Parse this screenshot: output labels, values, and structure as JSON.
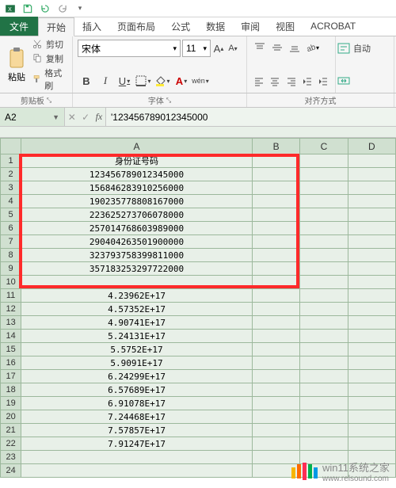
{
  "qat": {
    "excel_icon": "X",
    "save": "save",
    "undo": "undo",
    "redo": "redo"
  },
  "tabs": {
    "file": "文件",
    "items": [
      "开始",
      "插入",
      "页面布局",
      "公式",
      "数据",
      "审阅",
      "视图",
      "ACROBAT"
    ],
    "active_index": 0
  },
  "ribbon": {
    "clipboard": {
      "paste": "粘贴",
      "cut": "剪切",
      "copy": "复制",
      "format_painter": "格式刷"
    },
    "font": {
      "name": "宋体",
      "size": "11",
      "bold": "B",
      "italic": "I",
      "underline": "U",
      "wen": "wén"
    },
    "wrap": {
      "auto": "自动"
    },
    "group_titles": {
      "clipboard": "剪贴板",
      "font": "字体",
      "align": "对齐方式"
    }
  },
  "formula_bar": {
    "name_box": "A2",
    "value": "'123456789012345000"
  },
  "grid": {
    "col_headers": [
      "A",
      "B",
      "C",
      "D"
    ],
    "header_row": "身份证号码",
    "rows": [
      "123456789012345000",
      "156846283910256000",
      "190235778808167000",
      "223625273706078000",
      "257014768603989000",
      "290404263501900000",
      "323793758399811000",
      "357183253297722000",
      "",
      "4.23962E+17",
      "4.57352E+17",
      "4.90741E+17",
      "5.24131E+17",
      "5.5752E+17",
      "5.9091E+17",
      "6.24299E+17",
      "6.57689E+17",
      "6.91078E+17",
      "7.24468E+17",
      "7.57857E+17",
      "7.91247E+17",
      "",
      ""
    ]
  },
  "watermark": {
    "text": "win11系统之家",
    "url": "www.relsound.com"
  },
  "colors": {
    "wm_bars": [
      "#f7b500",
      "#ff6a00",
      "#ff2d55",
      "#00b14f",
      "#0099e5"
    ]
  }
}
